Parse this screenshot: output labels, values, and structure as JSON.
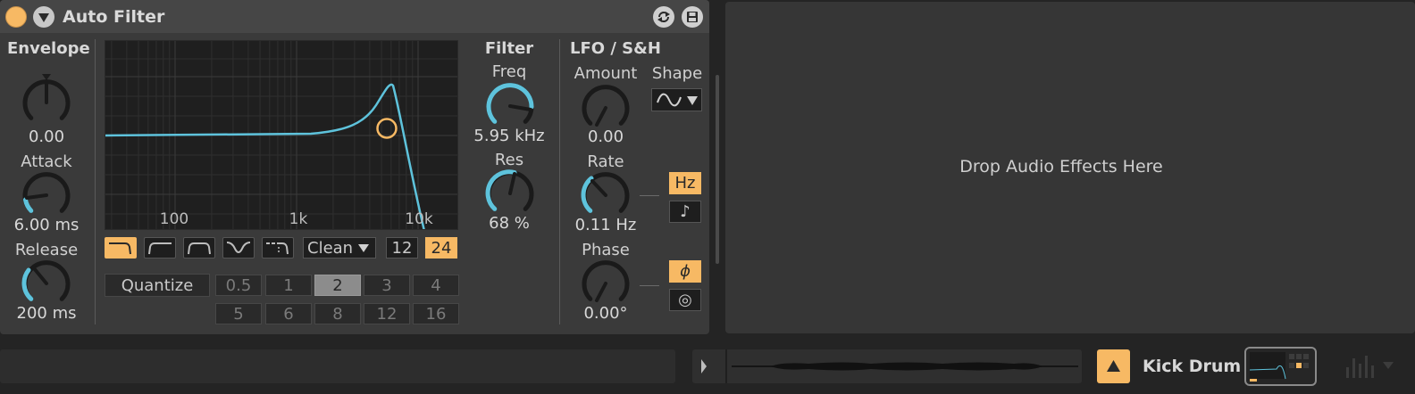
{
  "device": {
    "title": "Auto Filter",
    "envelope": {
      "header": "Envelope",
      "amount_value": "0.00",
      "attack_label": "Attack",
      "attack_value": "6.00 ms",
      "release_label": "Release",
      "release_value": "200 ms"
    },
    "graph": {
      "freq_ticks": [
        "100",
        "1k",
        "10k"
      ]
    },
    "filter_types": [
      "lowpass",
      "highpass",
      "bandpass",
      "notch",
      "morph"
    ],
    "filter_types_active": 0,
    "circuit": "Clean",
    "slope_options": [
      "12",
      "24"
    ],
    "slope_active": "24",
    "quantize": {
      "label": "Quantize",
      "row1": [
        "0.5",
        "1",
        "2",
        "3",
        "4"
      ],
      "row2": [
        "5",
        "6",
        "8",
        "12",
        "16"
      ],
      "selected": "2"
    },
    "filter": {
      "header": "Filter",
      "freq_label": "Freq",
      "freq_value": "5.95 kHz",
      "res_label": "Res",
      "res_value": "68 %"
    },
    "lfo": {
      "header": "LFO / S&H",
      "amount_label": "Amount",
      "amount_value": "0.00",
      "shape_label": "Shape",
      "rate_label": "Rate",
      "rate_value": "0.11 Hz",
      "rate_mode_hz": "Hz",
      "rate_mode_sync": "♪",
      "phase_label": "Phase",
      "phase_value": "0.00°",
      "phase_mode": "ϕ",
      "spin_mode": "◎"
    }
  },
  "dropzone": {
    "text": "Drop Audio Effects Here"
  },
  "bottom": {
    "track_name": "Kick Drum"
  },
  "colors": {
    "accent_orange": "#f7b964",
    "curve_cyan": "#5ec3dc",
    "panel": "#3a3a3a",
    "background": "#242424"
  }
}
